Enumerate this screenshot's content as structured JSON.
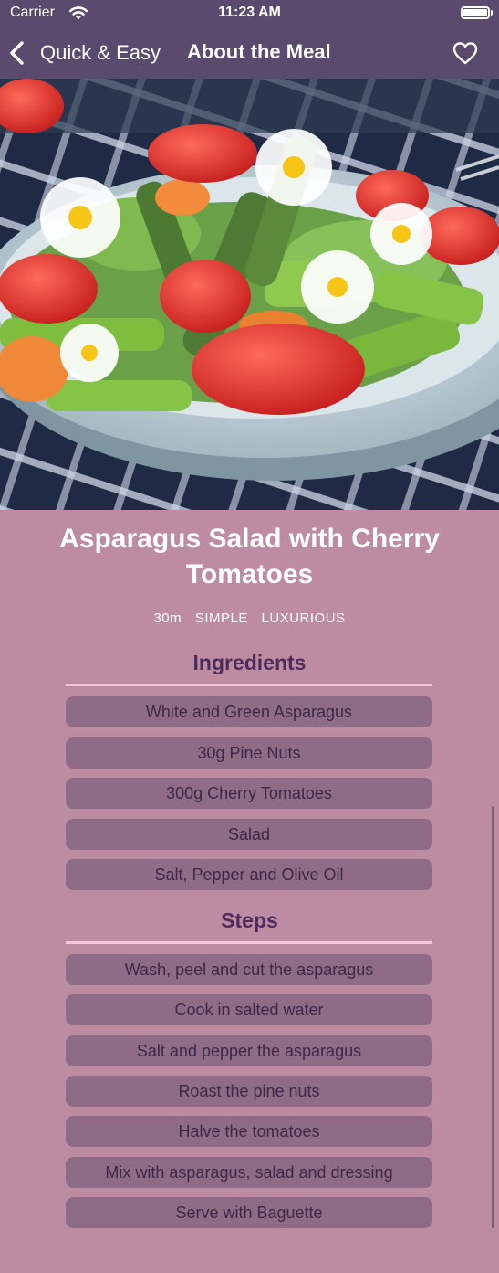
{
  "status": {
    "carrier": "Carrier",
    "time": "11:23 AM"
  },
  "nav": {
    "back_label": "Quick & Easy",
    "title": "About the Meal"
  },
  "meal": {
    "title": "Asparagus Salad with Cherry Tomatoes",
    "duration": "30m",
    "complexity": "SIMPLE",
    "affordability": "LUXURIOUS"
  },
  "ingredients": {
    "heading": "Ingredients",
    "items": [
      "White and Green Asparagus",
      "30g Pine Nuts",
      "300g Cherry Tomatoes",
      "Salad",
      "Salt, Pepper and Olive Oil"
    ]
  },
  "steps": {
    "heading": "Steps",
    "items": [
      "Wash, peel and cut the asparagus",
      "Cook in salted water",
      "Salt and pepper the asparagus",
      "Roast the pine nuts",
      "Halve the tomatoes",
      "Mix with asparagus, salad and dressing",
      "Serve with Baguette"
    ]
  },
  "colors": {
    "header": "#5a4a6d",
    "background": "#bd8ca2",
    "pill": "#8f6c85",
    "heading": "#4e2c5a",
    "divider": "#f4c8dc"
  },
  "icons": {
    "back": "chevron-left-icon",
    "favorite": "heart-outline-icon",
    "wifi": "wifi-icon",
    "battery": "battery-icon"
  }
}
